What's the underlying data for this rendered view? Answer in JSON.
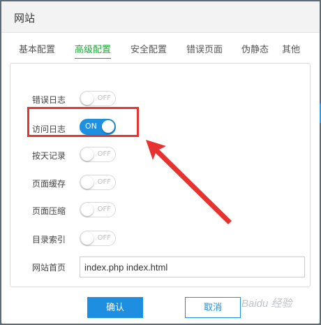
{
  "dialog": {
    "title": "网站"
  },
  "tabs": [
    {
      "label": "基本配置",
      "active": false
    },
    {
      "label": "高级配置",
      "active": true
    },
    {
      "label": "安全配置",
      "active": false
    },
    {
      "label": "错误页面",
      "active": false
    },
    {
      "label": "伪静态",
      "active": false
    },
    {
      "label": "其他",
      "active": false
    }
  ],
  "settings": [
    {
      "label": "错误日志",
      "state": "OFF",
      "enabled": false
    },
    {
      "label": "访问日志",
      "state": "ON",
      "enabled": true
    },
    {
      "label": "按天记录",
      "state": "OFF",
      "enabled": false
    },
    {
      "label": "页面缓存",
      "state": "OFF",
      "enabled": false
    },
    {
      "label": "页面压缩",
      "state": "OFF",
      "enabled": false
    },
    {
      "label": "目录索引",
      "state": "OFF",
      "enabled": false
    }
  ],
  "index_page": {
    "label": "网站首页",
    "value": "index.php index.html"
  },
  "buttons": {
    "confirm": "确认",
    "cancel": "取消"
  },
  "watermark": "Baidu 经验",
  "colors": {
    "accent": "#1e8fe0",
    "active_tab": "#20a53a",
    "annotation": "#e8322f"
  }
}
